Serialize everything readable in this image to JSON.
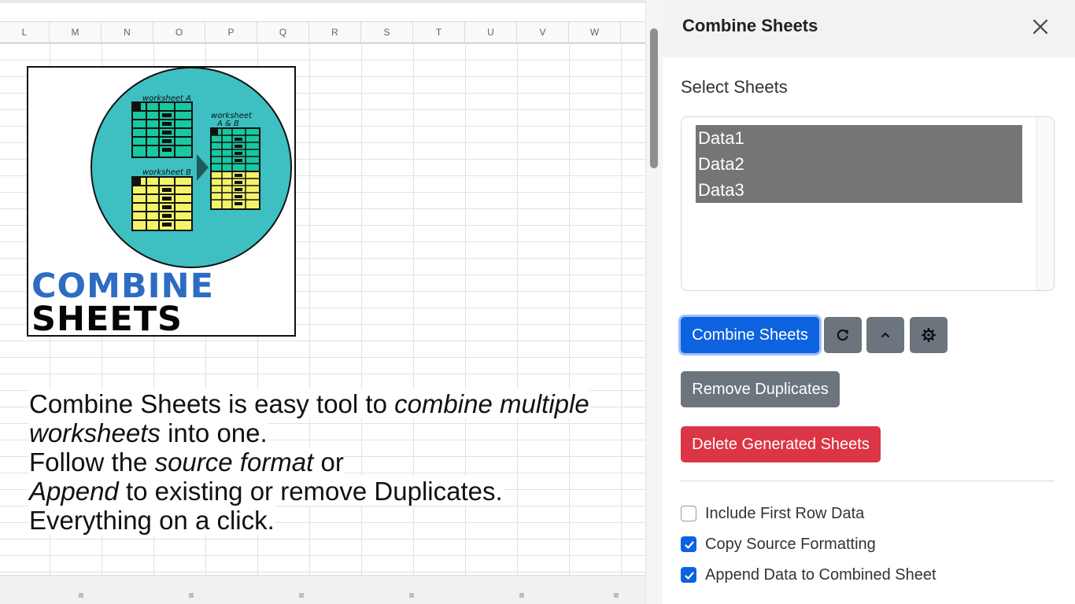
{
  "sheet": {
    "columns": [
      "L",
      "M",
      "N",
      "O",
      "P",
      "Q",
      "R",
      "S",
      "T",
      "U",
      "V",
      "W"
    ],
    "logo": {
      "worksheet_a_label": "worksheet A",
      "worksheet_b_label": "worksheet B",
      "worksheet_ab_label_1": "worksheet",
      "worksheet_ab_label_2": "A & B",
      "word1": "COMBINE",
      "word2": "SHEETS",
      "colors": {
        "circle": "#3ebfc1",
        "table_a": "#17c8a0",
        "table_b": "#f3f369",
        "word1": "#2d6cc2",
        "word2": "#050505"
      }
    },
    "description": {
      "l1_bold": "Combine Sheets",
      "l1_mid": " is easy tool to ",
      "l1_italic": "combine multiple",
      "l2_italic": "worksheets",
      "l2_rest": " into one.",
      "l3_pre": "Follow the ",
      "l3_italic": "source format",
      "l3_post": " or",
      "l4_italic": "Append",
      "l4_mid": " to existing or ",
      "l4_em": "remove Duplicates.",
      "l5": "Everything on a click."
    }
  },
  "panel": {
    "title": "Combine Sheets",
    "close_icon": "close-icon",
    "select_label": "Select Sheets",
    "sheets": [
      "Data1",
      "Data2",
      "Data3"
    ],
    "buttons": {
      "combine": "Combine Sheets",
      "refresh_icon": "refresh-icon",
      "collapse_icon": "chevron-up-icon",
      "settings_icon": "gear-icon",
      "remove_duplicates": "Remove Duplicates",
      "delete_generated": "Delete Generated Sheets"
    },
    "options": [
      {
        "label": "Include First Row Data",
        "checked": false
      },
      {
        "label": "Copy Source Formatting",
        "checked": true
      },
      {
        "label": "Append Data to Combined Sheet",
        "checked": true
      }
    ],
    "colors": {
      "primary": "#0d62e0",
      "secondary": "#6c757d",
      "danger": "#dc3545",
      "selected_item": "#757575"
    }
  }
}
